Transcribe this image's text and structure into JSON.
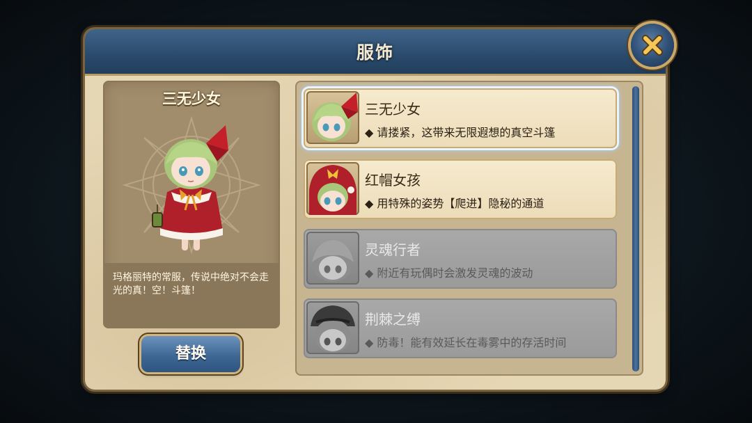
{
  "dialog": {
    "title": "服饰",
    "close_icon": "close-x-icon"
  },
  "preview": {
    "name": "三无少女",
    "description": "玛格丽特的常服，传说中绝对不会走光的真！空！斗篷！"
  },
  "replace_button": "替换",
  "outfits": [
    {
      "name": "三无少女",
      "description": "◆ 请搂紧，这带来无限遐想的真空斗篷",
      "state": "selected"
    },
    {
      "name": "红帽女孩",
      "description": "◆ 用特殊的姿势【爬进】隐秘的通道",
      "state": "unlocked"
    },
    {
      "name": "灵魂行者",
      "description": "◆ 附近有玩偶时会激发灵魂的波动",
      "state": "locked"
    },
    {
      "name": "荆棘之缚",
      "description": "◆ 防毒！能有效延长在毒雾中的存活时间",
      "state": "locked"
    }
  ],
  "colors": {
    "title_bar": "#2a4a6c",
    "panel": "#e6d7b4",
    "accent_gold": "#c9a86a",
    "button_blue": "#3e6794"
  }
}
